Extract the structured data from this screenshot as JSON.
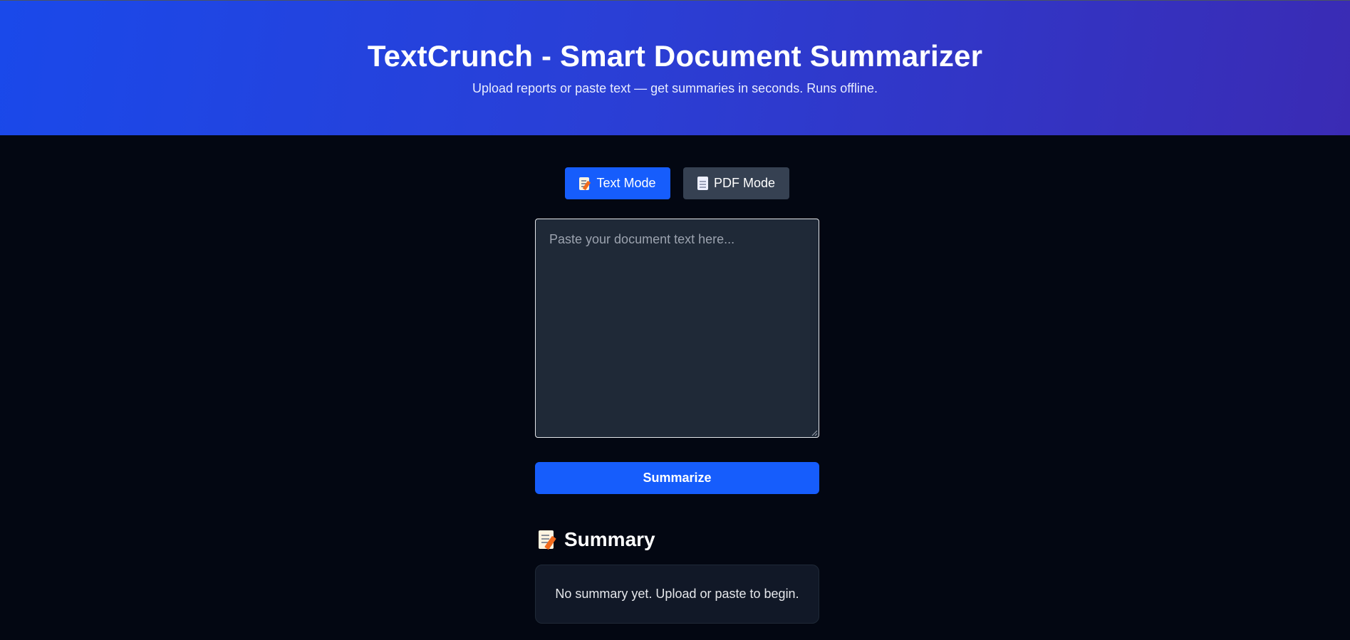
{
  "header": {
    "title": "TextCrunch - Smart Document Summarizer",
    "subtitle": "Upload reports or paste text — get summaries in seconds. Runs offline."
  },
  "modes": {
    "text_label": "Text Mode",
    "text_icon": "memo-icon",
    "pdf_label": "PDF Mode",
    "pdf_icon": "page-icon",
    "active": "Text Mode"
  },
  "editor": {
    "placeholder": "Paste your document text here...",
    "value": ""
  },
  "actions": {
    "summarize_label": "Summarize"
  },
  "summary": {
    "heading": "Summary",
    "heading_icon": "memo-icon",
    "empty_text": "No summary yet. Upload or paste to begin."
  },
  "colors": {
    "accent": "#165dfc",
    "header_gradient_start": "#1a49ea",
    "header_gradient_end": "#3a2bb4",
    "background": "#030712",
    "secondary_button": "#364152",
    "textarea_bg": "#1f2937",
    "summary_box_bg": "#111827"
  }
}
